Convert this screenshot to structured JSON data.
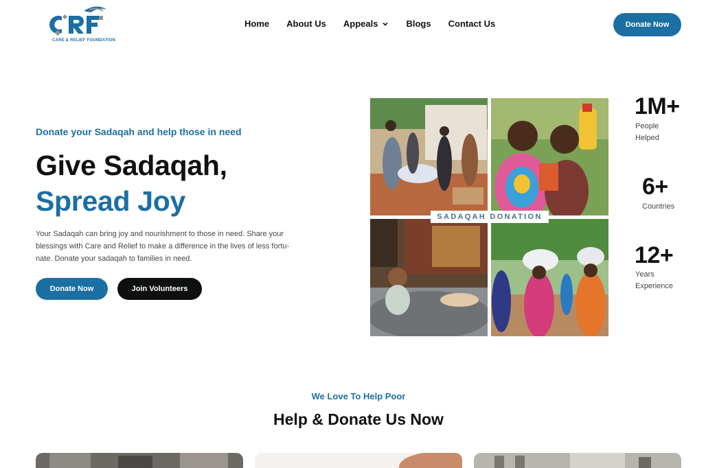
{
  "brand": {
    "logo_text": "CRF",
    "logo_tagline": "CARE & RELIEF FOUNDATION",
    "colors": {
      "primary": "#1b6fa3",
      "dark": "#0e0f10",
      "logo_gray": "#8d949b"
    }
  },
  "nav": {
    "items": [
      {
        "label": "Home"
      },
      {
        "label": "About Us"
      },
      {
        "label": "Appeals",
        "has_dropdown": true
      },
      {
        "label": "Blogs"
      },
      {
        "label": "Contact Us"
      }
    ],
    "cta_label": "Donate Now"
  },
  "hero": {
    "eyebrow": "Donate your Sadaqah and help those in need",
    "title_line1": "Give Sadaqah,",
    "title_line2": "Spread Joy",
    "description": "Your Sadaqah can bring joy and nourishment to those in need. Share your blessings with Care and Relief to make a difference in the lives of less fortu- nate. Donate your sadaqah to families in need.",
    "primary_button": "Donate Now",
    "secondary_button": "Join Volunteers",
    "collage_label": "SADAQAH DONATION"
  },
  "stats": [
    {
      "value": "1M+",
      "label_line1": "People",
      "label_line2": "Helped"
    },
    {
      "value": "6+",
      "label_line1": "Countries",
      "label_line2": ""
    },
    {
      "value": "12+",
      "label_line1": "Years",
      "label_line2": "Experience"
    }
  ],
  "section": {
    "eyebrow": "We Love To Help Poor",
    "title": "Help & Donate Us Now"
  }
}
